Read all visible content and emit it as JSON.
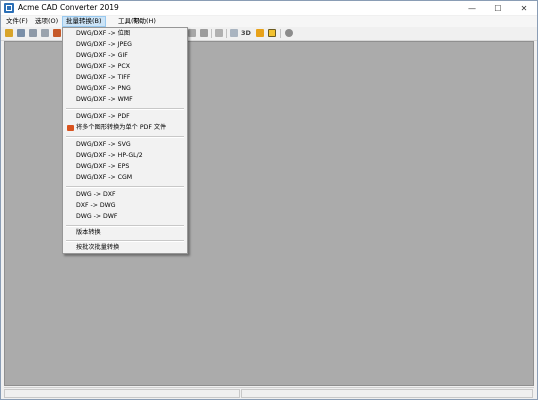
{
  "window": {
    "title": "Acme CAD Converter 2019",
    "controls": [
      "—",
      "☐",
      "✕"
    ]
  },
  "menubar": {
    "items": [
      {
        "label": "文件(F)"
      },
      {
        "label": "选项(O)"
      },
      {
        "label": "批量转换(B)"
      },
      {
        "label": "工具(T)"
      },
      {
        "label": "帮助(H)"
      }
    ]
  },
  "toolbar": {
    "text_3d": "3D"
  },
  "batch_menu": {
    "group1": [
      "DWG/DXF -> 位图",
      "DWG/DXF -> JPEG",
      "DWG/DXF -> GIF",
      "DWG/DXF -> PCX",
      "DWG/DXF -> TIFF",
      "DWG/DXF -> PNG",
      "DWG/DXF -> WMF"
    ],
    "group2": [
      "DWG/DXF -> PDF",
      "将多个图形转换为单个 PDF 文件"
    ],
    "group3": [
      "DWG/DXF -> SVG",
      "DWG/DXF -> HP-GL/2",
      "DWG/DXF -> EPS",
      "DWG/DXF -> CGM"
    ],
    "group4": [
      "DWG -> DXF",
      "DXF -> DWG",
      "DWG -> DWF"
    ],
    "group5": [
      "版本转换"
    ],
    "group6": [
      "按批次批量转换"
    ]
  }
}
